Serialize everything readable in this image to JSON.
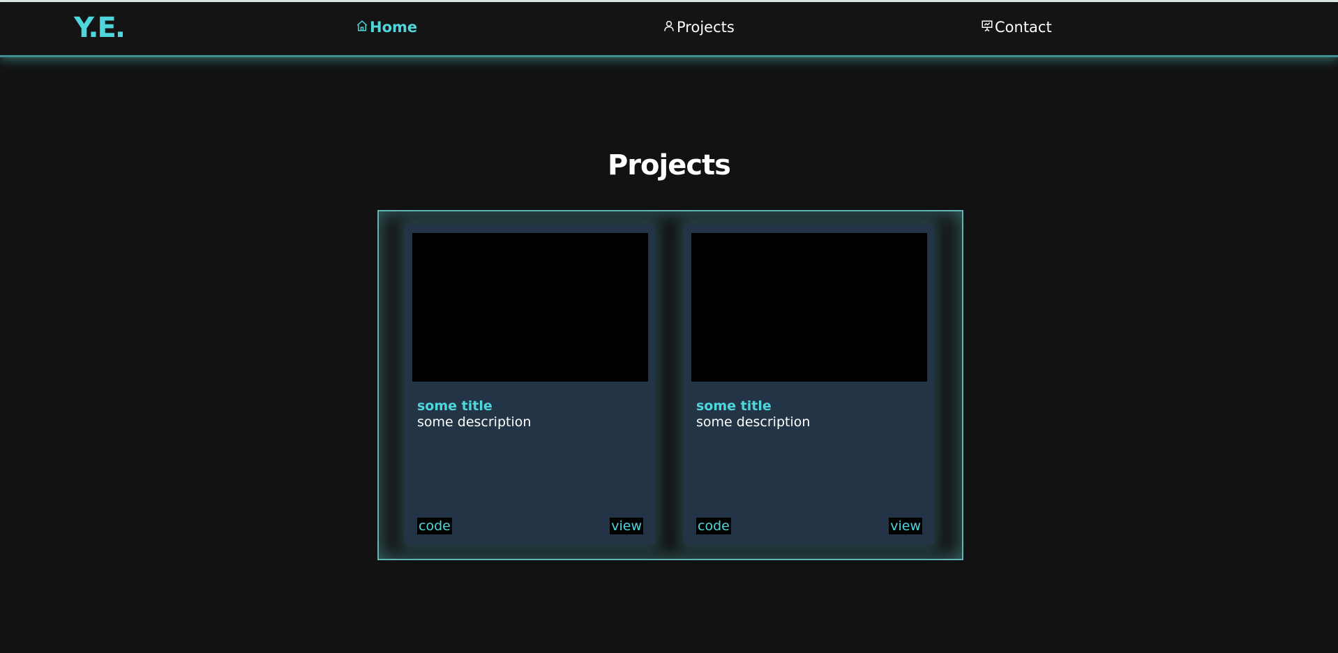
{
  "brand": {
    "logo": "Y.E.",
    "accent_color": "#4fd6dd"
  },
  "nav": {
    "items": [
      {
        "label": "Home",
        "icon": "home-icon",
        "active": true
      },
      {
        "label": "Projects",
        "icon": "user-icon",
        "active": false
      },
      {
        "label": "Contact",
        "icon": "presentation-icon",
        "active": false
      }
    ]
  },
  "main": {
    "title": "Projects",
    "cards": [
      {
        "title": "some title",
        "description": "some description",
        "code_label": "code",
        "view_label": "view"
      },
      {
        "title": "some title",
        "description": "some description",
        "code_label": "code",
        "view_label": "view"
      }
    ]
  }
}
